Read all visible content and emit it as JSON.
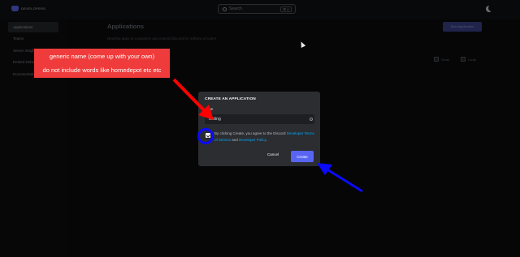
{
  "header": {
    "logo_text": "DEVELOPERS",
    "search_placeholder": "Search",
    "search_shortcut": "⌘ K"
  },
  "sidebar": {
    "items": [
      {
        "label": "Applications",
        "active": true
      },
      {
        "label": "Teams",
        "active": false
      },
      {
        "label": "Server Insights",
        "active": false
      },
      {
        "label": "Embed Debugger",
        "active": false
      },
      {
        "label": "Documentation",
        "active": false
      }
    ]
  },
  "main": {
    "title": "Applications",
    "subtitle": "Develop apps to customize and extend Discord for millions of users.",
    "new_app_button": "New Application",
    "view_small": "Small",
    "view_large": "Large"
  },
  "annotation": {
    "line1": "generic name (come up with your own)",
    "line2": "do not include words like homedepot etc etc",
    "box_color": "#ef3b3b",
    "red_arrow_color": "#ff0000",
    "blue_marker_color": "#0a0aff"
  },
  "modal": {
    "title": "CREATE AN APPLICATION",
    "name_label": "NAME",
    "name_value": "testing",
    "terms_prefix": "By clicking Create, you agree to the Discord ",
    "terms_link1": "Developer Terms of Service",
    "terms_mid": " and ",
    "terms_link2": "Developer Policy",
    "terms_suffix": ".",
    "cancel_label": "Cancel",
    "create_label": "Create",
    "accent_color": "#5865f2"
  }
}
